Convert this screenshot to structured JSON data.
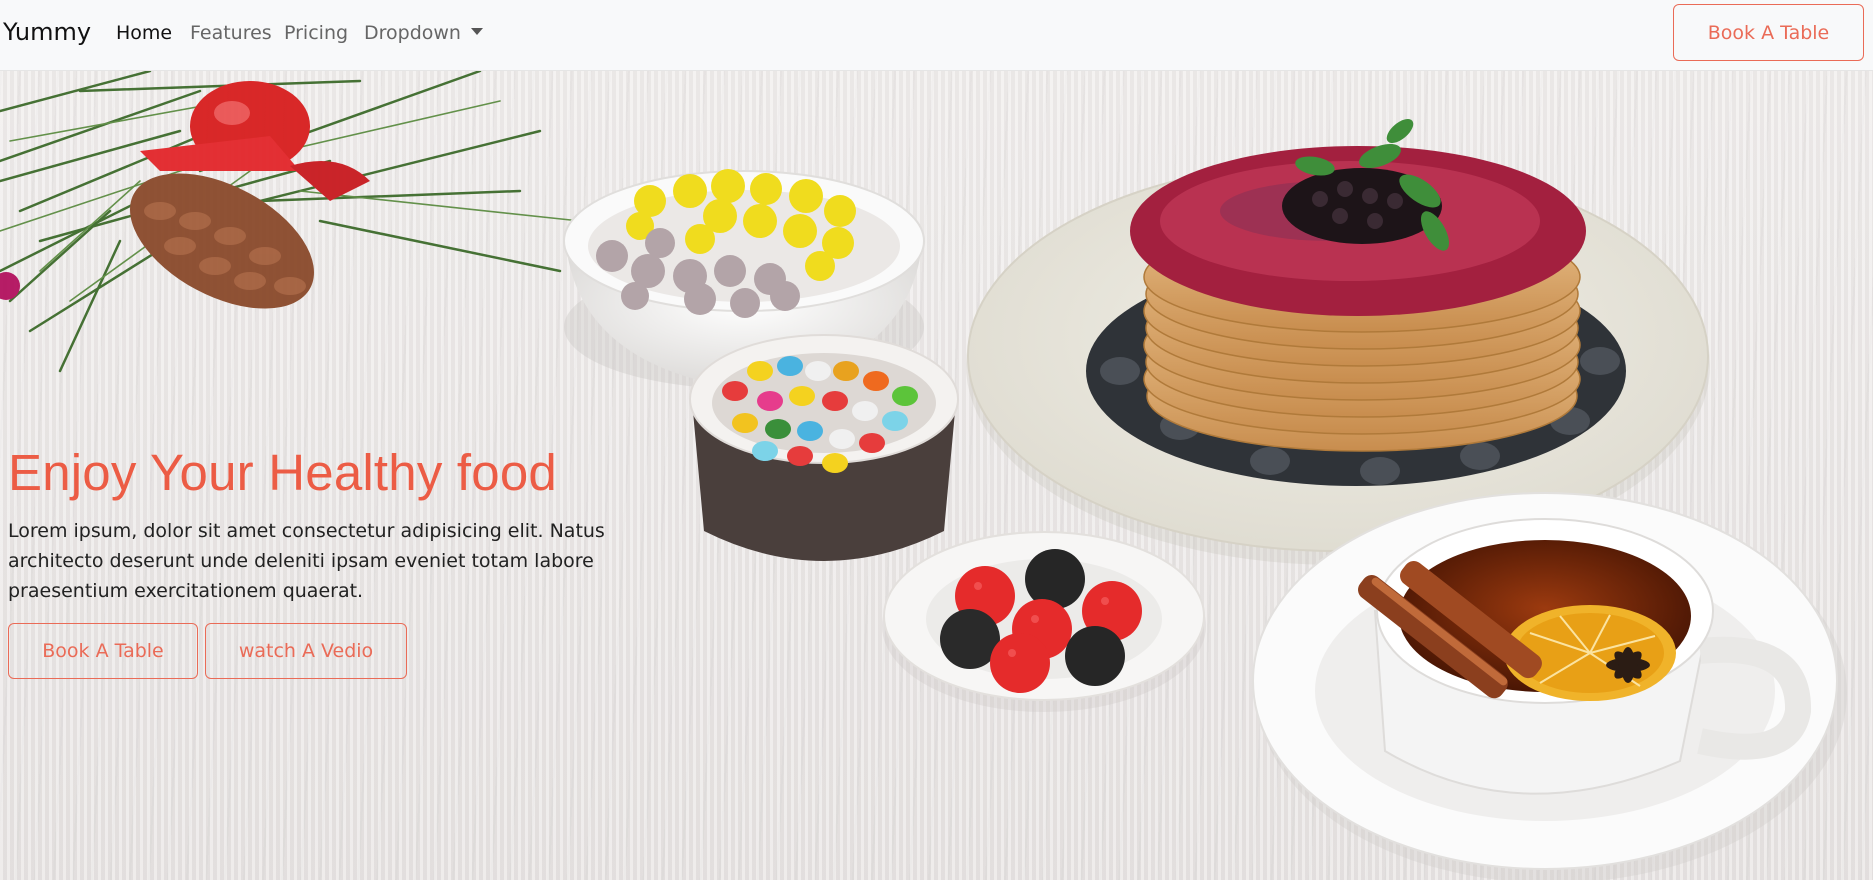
{
  "nav": {
    "brand": "Yummy",
    "links": [
      {
        "label": "Home",
        "active": true
      },
      {
        "label": "Features",
        "active": false
      },
      {
        "label": "Pricing",
        "active": false
      },
      {
        "label": "Dropdown",
        "active": false
      }
    ],
    "cta_label": "Book A Table"
  },
  "hero": {
    "title": "Enjoy Your Healthy food",
    "description": "Lorem ipsum, dolor sit amet consectetur adipisicing elit. Natus architecto deserunt unde deleniti ipsam eveniet totam labore praesentium exercitationem quaerat.",
    "primary_button": "Book A Table",
    "secondary_button": "watch A Vedio"
  },
  "colors": {
    "accent": "#ec5c45",
    "nav_bg": "#f8f9fa"
  }
}
